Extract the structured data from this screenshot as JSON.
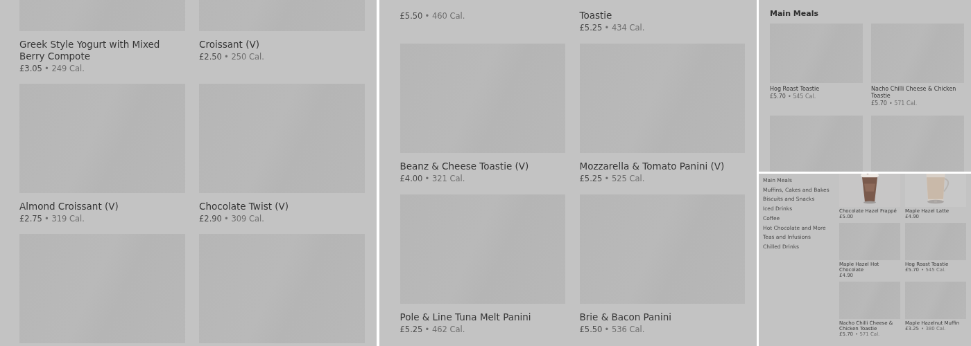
{
  "screens": [
    {
      "items": [
        {
          "kind": "placeholder",
          "name": "Greek Style Yogurt with Mixed Berry Compote",
          "price": "£3.05",
          "calories": "• 249 Cal."
        },
        {
          "kind": "placeholder",
          "name": "Croissant (V)",
          "price": "£2.50",
          "calories": "• 250 Cal."
        },
        {
          "kind": "placeholder",
          "name": "Almond Croissant (V)",
          "price": "£2.75",
          "calories": "• 319 Cal."
        },
        {
          "kind": "placeholder",
          "name": "Chocolate Twist (V)",
          "price": "£2.90",
          "calories": "• 309 Cal."
        },
        {
          "kind": "placeholder"
        },
        {
          "kind": "placeholder"
        }
      ]
    },
    {
      "items": [
        {
          "kind": "text_only",
          "price": "£5.50",
          "calories": "• 460 Cal."
        },
        {
          "kind": "text_only",
          "name": "Toastie",
          "price": "£5.25",
          "calories": "• 434 Cal."
        },
        {
          "kind": "placeholder",
          "name": "Beanz & Cheese Toastie (V)",
          "price": "£4.00",
          "calories": "• 321 Cal."
        },
        {
          "kind": "placeholder",
          "name": "Mozzarella & Tomato Panini (V)",
          "price": "£5.25",
          "calories": "• 525 Cal."
        },
        {
          "kind": "placeholder",
          "name": "Pole & Line Tuna Melt Panini",
          "price": "£5.25",
          "calories": "• 462 Cal."
        },
        {
          "kind": "placeholder",
          "name": "Brie & Bacon Panini",
          "price": "£5.50",
          "calories": "• 536 Cal."
        }
      ]
    },
    {
      "title": "Main Meals",
      "items": [
        {
          "kind": "placeholder",
          "name": "Hog Roast Toastie",
          "price": "£5.70",
          "calories": "• 545 Cal."
        },
        {
          "kind": "placeholder",
          "name": "Nacho Chilli Cheese & Chicken Toastie",
          "price": "£5.70",
          "calories": "• 571 Cal."
        },
        {
          "kind": "placeholder"
        },
        {
          "kind": "placeholder"
        }
      ]
    },
    {
      "categories": [
        "Main Meals",
        "Muffins, Cakes and Bakes",
        "Biscuits and Snacks",
        "Iced Drinks",
        "Coffee",
        "Hot Chocolate and More",
        "Teas and Infusions",
        "Chilled Drinks"
      ],
      "items": [
        {
          "name": "Chocolate Hazel Frappé",
          "price": "£5.00"
        },
        {
          "name": "Maple Hazel Latte",
          "price": "£4.90"
        },
        {
          "kind": "placeholder",
          "name": "Maple Hazel Hot Chocolate",
          "price": "£4.90"
        },
        {
          "kind": "placeholder",
          "name": "Hog Roast Toastie",
          "price": "£5.70",
          "calories": "• 545 Cal."
        },
        {
          "kind": "placeholder",
          "name": "Nacho Chilli Cheese & Chicken Toastie",
          "price": "£5.70",
          "calories": "• 571 Cal."
        },
        {
          "kind": "placeholder",
          "name": "Maple Hazelnut Muffin",
          "price": "£3.25",
          "calories": "• 380 Cal."
        }
      ]
    }
  ]
}
